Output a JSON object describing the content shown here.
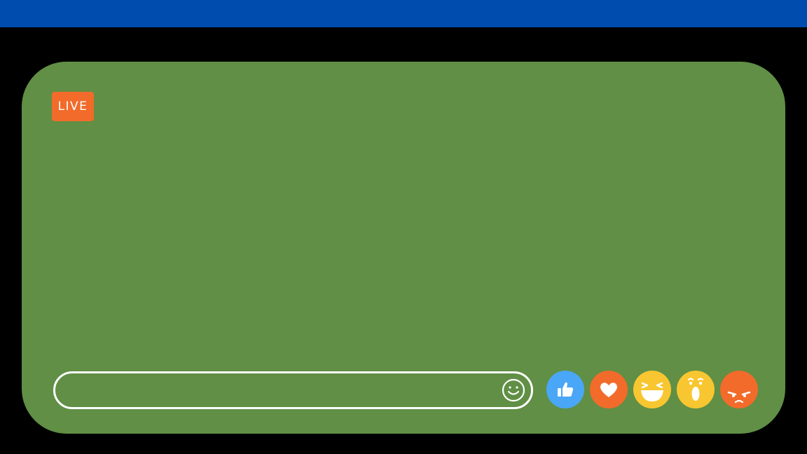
{
  "live_badge": {
    "label": "LIVE",
    "color": "#f26b2a"
  },
  "colors": {
    "top_bar": "#004bae",
    "background": "#000000",
    "video_frame": "#608f45"
  },
  "comment": {
    "value": "",
    "placeholder": "",
    "emoji_icon": "smiley-icon"
  },
  "reactions": [
    {
      "name": "like",
      "icon": "thumbs-up-icon",
      "color": "#4aa6f6"
    },
    {
      "name": "love",
      "icon": "heart-icon",
      "color": "#f26b2a"
    },
    {
      "name": "haha",
      "icon": "laughing-face-icon",
      "color": "#f8c630"
    },
    {
      "name": "wow",
      "icon": "surprised-face-icon",
      "color": "#f8c630"
    },
    {
      "name": "angry",
      "icon": "angry-face-icon",
      "color": "#f26b2a"
    }
  ]
}
